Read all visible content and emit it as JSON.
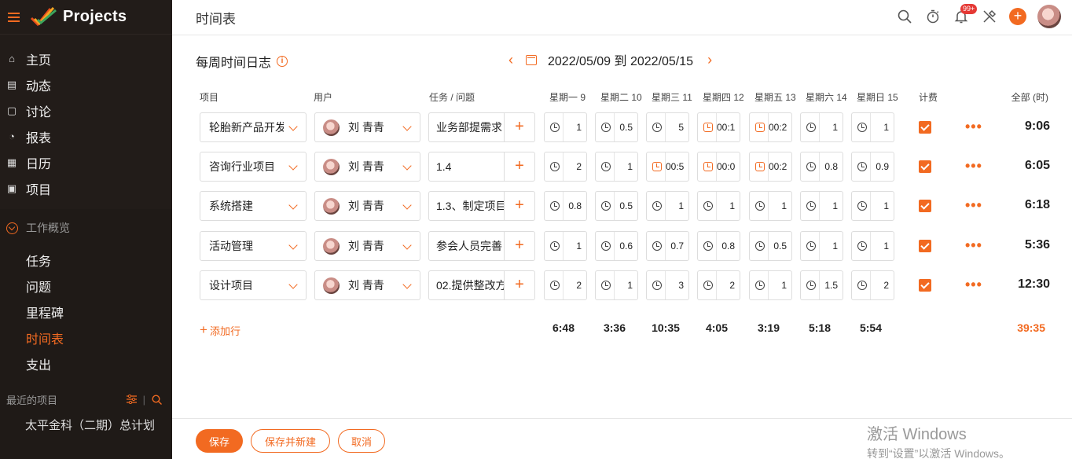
{
  "app": {
    "name": "Projects"
  },
  "nav": [
    {
      "label": "主页",
      "icon": "home-icon"
    },
    {
      "label": "动态",
      "icon": "feed-icon"
    },
    {
      "label": "讨论",
      "icon": "discuss-icon"
    },
    {
      "label": "报表",
      "icon": "report-icon"
    },
    {
      "label": "日历",
      "icon": "calendar-icon"
    },
    {
      "label": "项目",
      "icon": "briefcase-icon"
    }
  ],
  "section": {
    "title": "工作概览",
    "items": [
      "任务",
      "问题",
      "里程碑",
      "时间表",
      "支出"
    ],
    "active_index": 3
  },
  "recent": {
    "title": "最近的项目",
    "project": "太平金科（二期）总计划"
  },
  "header": {
    "page_title": "时间表",
    "notification_badge": "99+"
  },
  "main": {
    "log_title": "每周时间日志",
    "date_range": "2022/05/09 到 2022/05/15",
    "columns": {
      "project": "项目",
      "user": "用户",
      "task": "任务 / 问题",
      "days": [
        "星期一 9",
        "星期二 10",
        "星期三 11",
        "星期四 12",
        "星期五 13",
        "星期六 14",
        "星期日 15"
      ],
      "billable": "计费",
      "total": "全部 (时)"
    },
    "rows": [
      {
        "project": "轮胎新产品开发",
        "user": "刘 青青",
        "task": "业务部提需求",
        "cells": [
          "1",
          "0.5",
          "5",
          "00:1",
          "00:2",
          "1",
          "1"
        ],
        "timers": [
          false,
          false,
          false,
          true,
          true,
          false,
          false
        ],
        "total": "9:06"
      },
      {
        "project": "咨询行业项目",
        "user": "刘 青青",
        "task": "1.4",
        "cells": [
          "2",
          "1",
          "00:5",
          "00:0",
          "00:2",
          "0.8",
          "0.9"
        ],
        "timers": [
          false,
          false,
          true,
          true,
          true,
          false,
          false
        ],
        "total": "6:05"
      },
      {
        "project": "系统搭建",
        "user": "刘 青青",
        "task": "1.3、制定项目",
        "cells": [
          "0.8",
          "0.5",
          "1",
          "1",
          "1",
          "1",
          "1"
        ],
        "timers": [
          false,
          false,
          false,
          false,
          false,
          false,
          false
        ],
        "total": "6:18"
      },
      {
        "project": "活动管理",
        "user": "刘 青青",
        "task": "参会人员完善",
        "cells": [
          "1",
          "0.6",
          "0.7",
          "0.8",
          "0.5",
          "1",
          "1"
        ],
        "timers": [
          false,
          false,
          false,
          false,
          false,
          false,
          false
        ],
        "total": "5:36"
      },
      {
        "project": "设计项目",
        "user": "刘 青青",
        "task": "02.提供整改方",
        "cells": [
          "2",
          "1",
          "3",
          "2",
          "1",
          "1.5",
          "2"
        ],
        "timers": [
          false,
          false,
          false,
          false,
          false,
          false,
          false
        ],
        "total": "12:30"
      }
    ],
    "add_row": "添加行",
    "day_totals": [
      "6:48",
      "3:36",
      "10:35",
      "4:05",
      "3:19",
      "5:18",
      "5:54"
    ],
    "grand_total": "39:35"
  },
  "footer": {
    "save": "保存",
    "save_new": "保存并新建",
    "cancel": "取消"
  },
  "watermark": {
    "line1": "激活 Windows",
    "line2": "转到“设置”以激活 Windows。"
  },
  "colors": {
    "accent": "#f26a21",
    "sidebar_bg": "#1f1a17"
  }
}
